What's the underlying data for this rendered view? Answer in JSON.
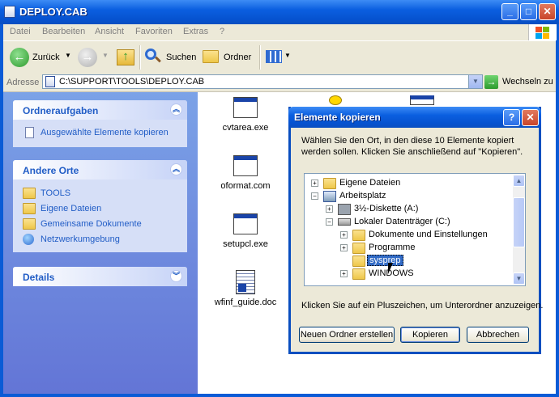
{
  "window": {
    "title": "DEPLOY.CAB"
  },
  "menu": [
    "Datei",
    "Bearbeiten",
    "Ansicht",
    "Favoriten",
    "Extras",
    "?"
  ],
  "toolbar": {
    "back": "Zurück",
    "search": "Suchen",
    "folders": "Ordner"
  },
  "address": {
    "label": "Adresse",
    "value": "C:\\SUPPORT\\TOOLS\\DEPLOY.CAB",
    "go": "Wechseln zu"
  },
  "taskpane": {
    "tasks": {
      "title": "Ordneraufgaben",
      "items": [
        "Ausgewählte Elemente kopieren"
      ]
    },
    "places": {
      "title": "Andere Orte",
      "items": [
        "TOOLS",
        "Eigene Dateien",
        "Gemeinsame Dokumente",
        "Netzwerkumgebung"
      ]
    },
    "details": {
      "title": "Details"
    }
  },
  "files": [
    "cvtarea.exe",
    "oformat.com",
    "setupcl.exe",
    "wfinf_guide.doc"
  ],
  "dialog": {
    "title": "Elemente kopieren",
    "message": "Wählen Sie den Ort, in den diese 10 Elemente kopiert werden sollen. Klicken Sie anschließend auf \"Kopieren\".",
    "tree": [
      {
        "label": "Eigene Dateien",
        "toggle": "+"
      },
      {
        "label": "Arbeitsplatz",
        "toggle": "−"
      },
      {
        "label": "3½-Diskette (A:)",
        "toggle": "+"
      },
      {
        "label": "Lokaler Datenträger (C:)",
        "toggle": "−"
      },
      {
        "label": "Dokumente und Einstellungen",
        "toggle": "+"
      },
      {
        "label": "Programme",
        "toggle": "+"
      },
      {
        "label": "sysprep",
        "toggle": ""
      },
      {
        "label": "WINDOWS",
        "toggle": "+"
      }
    ],
    "hint": "Klicken Sie auf ein Pluszeichen, um Unterordner anzuzeigen.",
    "buttons": {
      "new_folder": "Neuen Ordner erstellen",
      "copy": "Kopieren",
      "cancel": "Abbrechen"
    }
  }
}
